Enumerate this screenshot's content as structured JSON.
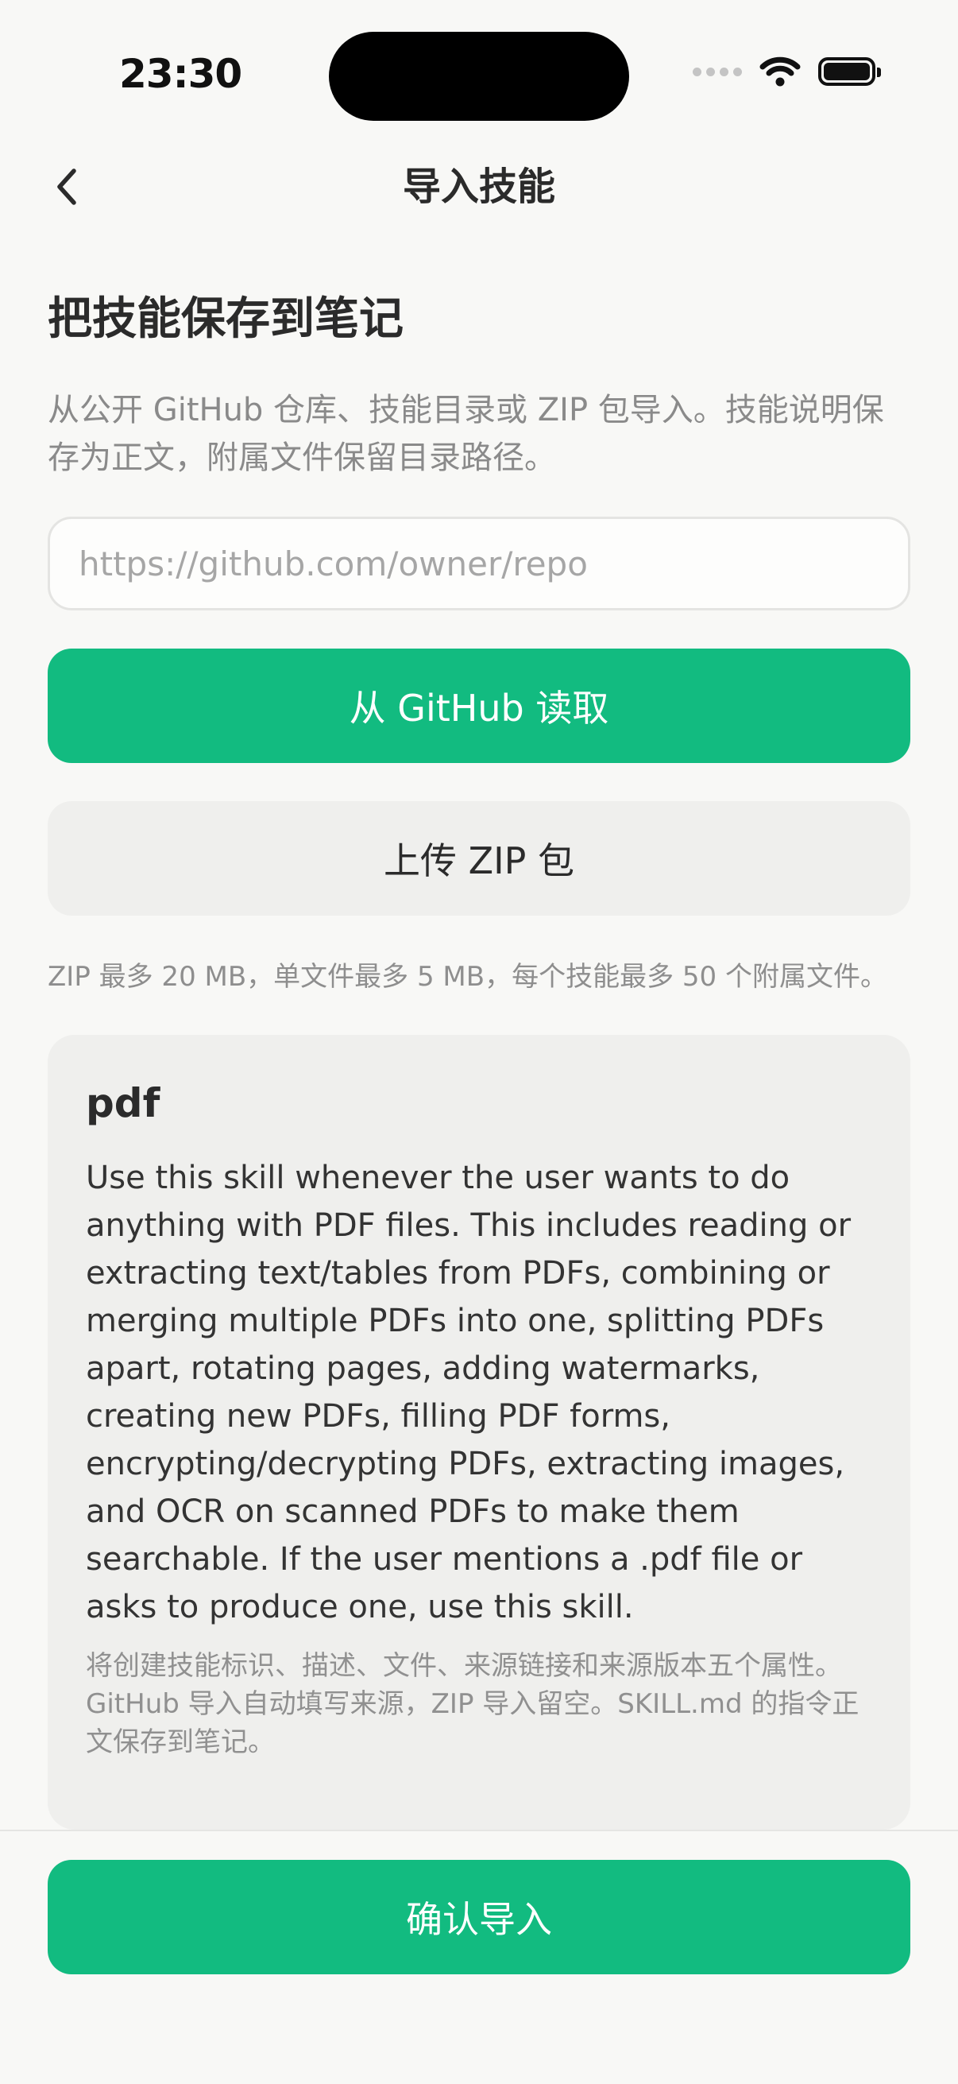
{
  "status_bar": {
    "time": "23:30"
  },
  "nav": {
    "back_icon": "chevron-left-icon",
    "title": "导入技能"
  },
  "main": {
    "heading": "把技能保存到笔记",
    "intro": "从公开 GitHub 仓库、技能目录或 ZIP 包导入。技能说明保存为正文，附属文件保留目录路径。",
    "url_input": {
      "value": "",
      "placeholder": "https://github.com/owner/repo"
    },
    "github_button_label": "从 GitHub 读取",
    "zip_button_label": "上传 ZIP 包",
    "limits_text": "ZIP 最多 20 MB，单文件最多 5 MB，每个技能最多 50 个附属文件。"
  },
  "skill_card": {
    "name": "pdf",
    "description": "Use this skill whenever the user wants to do anything with PDF files. This includes reading or extracting text/tables from PDFs, combining or merging multiple PDFs into one, splitting PDFs apart, rotating pages, adding watermarks, creating new PDFs, filling PDF forms, encrypting/decrypting PDFs, extracting images, and OCR on scanned PDFs to make them searchable. If the user mentions a .pdf file or asks to produce one, use this skill.",
    "note": "将创建技能标识、描述、文件、来源链接和来源版本五个属性。GitHub 导入自动填写来源，ZIP 导入留空。SKILL.md 的指令正文保存到笔记。"
  },
  "footer": {
    "confirm_button_label": "确认导入"
  },
  "colors": {
    "accent": "#12bb80",
    "background": "#f8f8f6",
    "card": "#efefed"
  }
}
